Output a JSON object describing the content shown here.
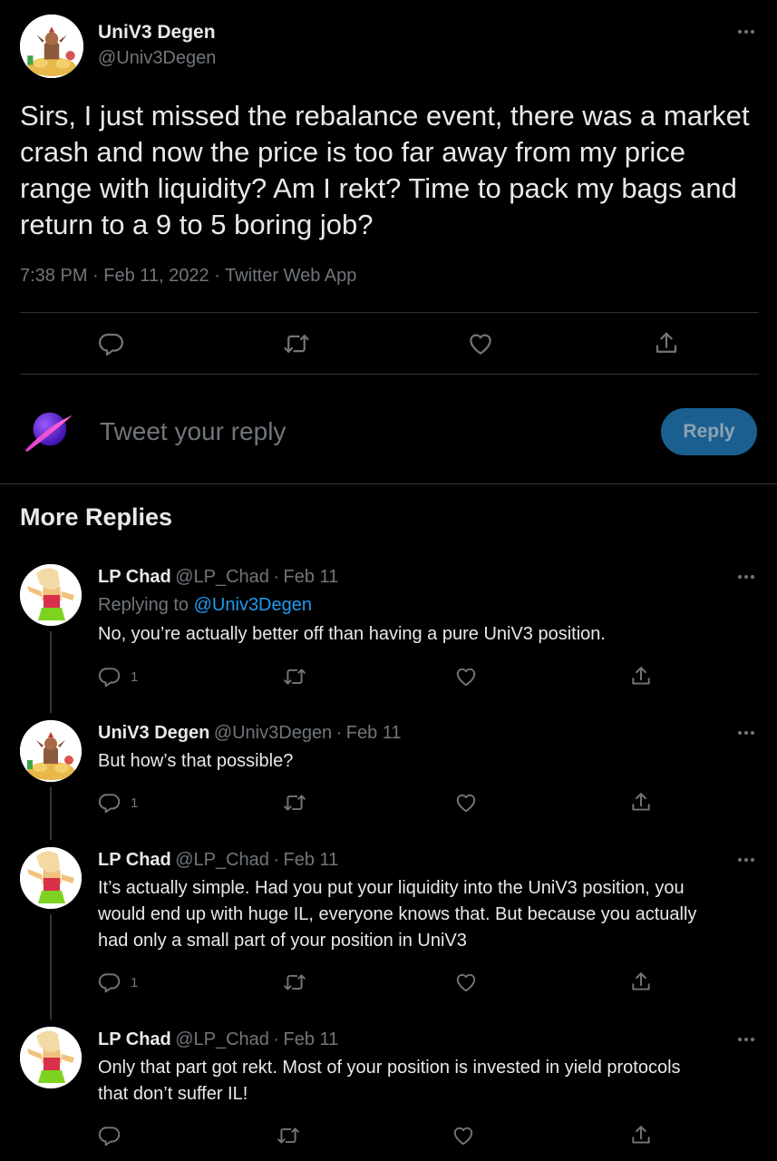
{
  "main_tweet": {
    "author_name": "UniV3 Degen",
    "author_handle": "@Univ3Degen",
    "text": "Sirs, I just missed the rebalance event, there was a market crash and now the price is too far away from my price range with liquidity? Am I rekt? Time to pack my bags and return to a 9 to 5 boring job?",
    "time": "7:38 PM",
    "date": "Feb 11, 2022",
    "source": "Twitter Web App",
    "sep": "·"
  },
  "compose": {
    "placeholder": "Tweet your reply",
    "reply_button": "Reply"
  },
  "section_title": "More Replies",
  "replies": [
    {
      "name": "LP Chad",
      "handle": "@LP_Chad",
      "date": "Feb 11",
      "replying_to_prefix": "Replying to",
      "replying_to_handle": "@Univ3Degen",
      "text": "No, you’re actually better off than having a pure UniV3 position.",
      "reply_count": "1"
    },
    {
      "name": "UniV3 Degen",
      "handle": "@Univ3Degen",
      "date": "Feb 11",
      "text": "But how’s that possible?",
      "reply_count": "1"
    },
    {
      "name": "LP Chad",
      "handle": "@LP_Chad",
      "date": "Feb 11",
      "text_lines": [
        "It’s actually simple. Had you put your liquidity into the UniV3 position, you",
        "would end up with huge IL, everyone knows that. But because you actually",
        "had only a small part of your position in UniV3"
      ],
      "reply_count": "1"
    },
    {
      "name": "LP Chad",
      "handle": "@LP_Chad",
      "date": "Feb 11",
      "text_lines": [
        "Only that part got rekt. Most of your position is invested in yield protocols",
        "that don’t suffer IL!"
      ]
    }
  ],
  "icons": {
    "reply": "reply-icon",
    "retweet": "retweet-icon",
    "like": "like-icon",
    "share": "share-icon",
    "more": "more-icon"
  },
  "colors": {
    "background": "#000000",
    "text": "#e7e9ea",
    "muted": "#71767b",
    "accent": "#1d9bf0",
    "reply_button_bg": "#1a5f8f"
  }
}
